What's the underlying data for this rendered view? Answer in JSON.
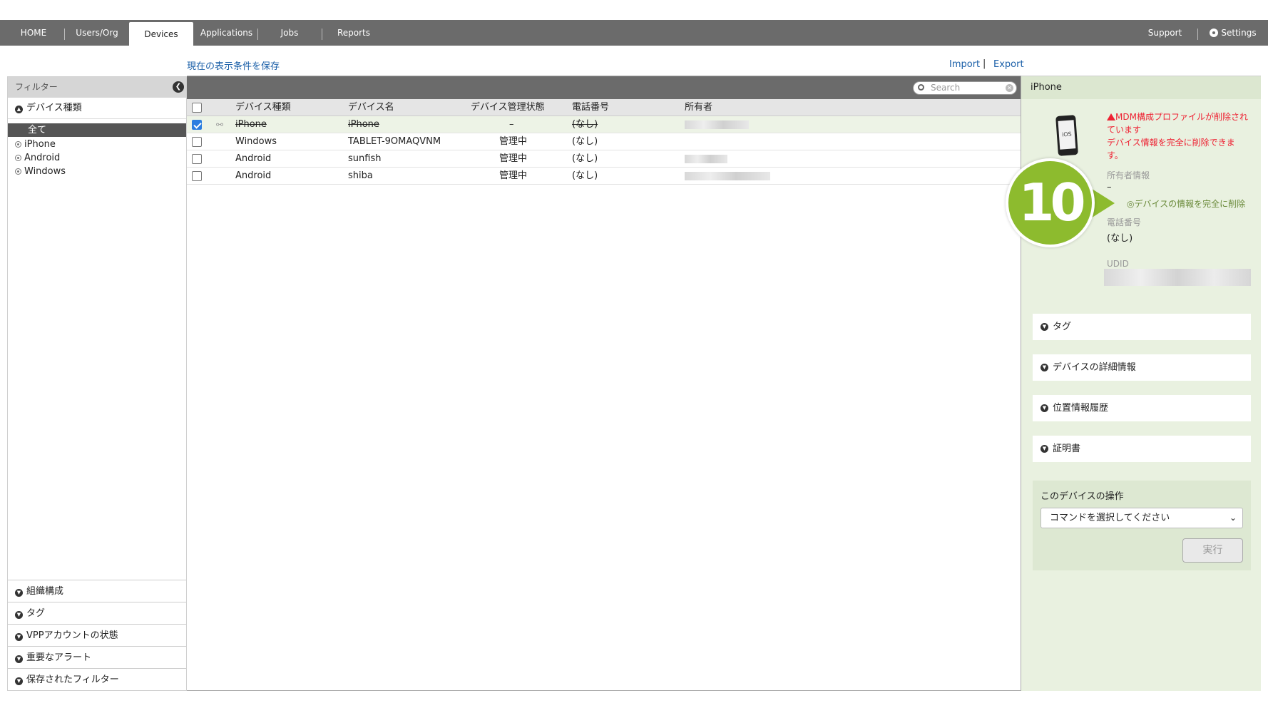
{
  "nav": {
    "items": [
      "HOME",
      "Users/Org",
      "Devices",
      "Applications",
      "Jobs",
      "Reports"
    ],
    "active": "Devices",
    "support": "Support",
    "settings": "Settings"
  },
  "toolbar": {
    "save_filter": "現在の表示条件を保存",
    "import": "Import",
    "separator": "|",
    "export": "Export"
  },
  "filter": {
    "header": "フィルター",
    "device_type_title": "デバイス種類",
    "items": [
      "全て",
      "iPhone",
      "Android",
      "Windows"
    ],
    "bottom_sections": [
      "組織構成",
      "タグ",
      "VPPアカウントの状態",
      "重要なアラート",
      "保存されたフィルター"
    ]
  },
  "table": {
    "search_placeholder": "Search",
    "columns": [
      "デバイス種類",
      "デバイス名",
      "デバイス管理状態",
      "電話番号",
      "所有者"
    ],
    "rows": [
      {
        "type": "iPhone",
        "name": "iPhone",
        "status": "–",
        "phone": "(なし)",
        "checked": true,
        "removed": true
      },
      {
        "type": "Windows",
        "name": "TABLET-9OMAQVNM",
        "status": "管理中",
        "phone": "(なし)",
        "checked": false,
        "removed": false
      },
      {
        "type": "Android",
        "name": "sunfish",
        "status": "管理中",
        "phone": "(なし)",
        "checked": false,
        "removed": false
      },
      {
        "type": "Android",
        "name": "shiba",
        "status": "管理中",
        "phone": "(なし)",
        "checked": false,
        "removed": false
      }
    ]
  },
  "detail": {
    "title": "iPhone",
    "phone_icon_label": "iOS",
    "warning_line1": "MDM構成プロファイルが削除されています",
    "warning_line2": "デバイス情報を完全に削除できます。",
    "owner_label": "所有者情報",
    "owner_value": "–",
    "delete_link": "デバイスの情報を完全に削除",
    "phone_label": "電話番号",
    "phone_value": "(なし)",
    "udid_label": "UDID",
    "accordions": [
      "タグ",
      "デバイスの詳細情報",
      "位置情報履歴",
      "証明書"
    ],
    "ops_title": "このデバイスの操作",
    "ops_select": "コマンドを選択してください",
    "ops_button": "実行"
  },
  "callout": {
    "number": "10",
    "color": "#8dbb2e"
  }
}
